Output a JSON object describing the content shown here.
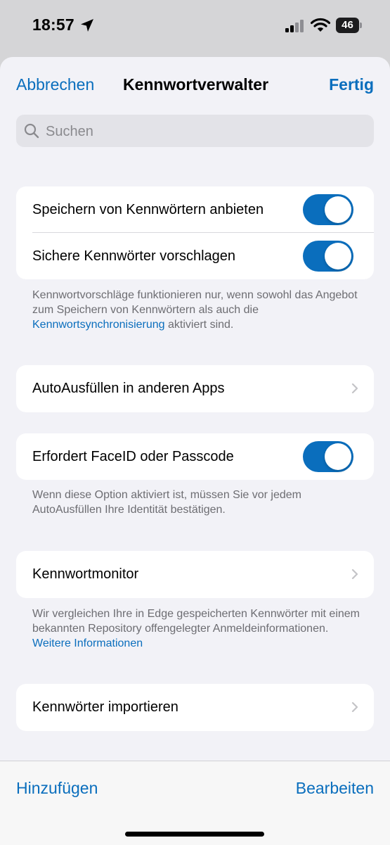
{
  "status_bar": {
    "time": "18:57",
    "battery": "46",
    "icons": [
      "location-arrow-icon",
      "cellular-signal-icon",
      "wifi-icon",
      "battery-icon"
    ]
  },
  "nav": {
    "cancel_label": "Abbrechen",
    "title": "Kennwortverwalter",
    "done_label": "Fertig"
  },
  "search": {
    "placeholder": "Suchen",
    "value": ""
  },
  "settings": {
    "offer_save": {
      "label": "Speichern von Kennwörtern anbieten",
      "enabled": true
    },
    "suggest_strong": {
      "label": "Sichere Kennwörter vorschlagen",
      "enabled": true
    },
    "sync_note": {
      "text_before": "Kennwortvorschläge funktionieren nur, wenn sowohl das Angebot zum Speichern von Kennwörtern als auch die ",
      "link": "Kennwortsynchronisierung",
      "text_after": " aktiviert sind."
    },
    "autofill_other_apps": {
      "label": "AutoAusfüllen in anderen Apps"
    },
    "require_faceid": {
      "label": "Erfordert FaceID oder Passcode",
      "enabled": true
    },
    "faceid_note": "Wenn diese Option aktiviert ist, müssen Sie vor jedem AutoAusfüllen Ihre Identität bestätigen.",
    "password_monitor": {
      "label": "Kennwortmonitor"
    },
    "monitor_note": {
      "text": "Wir vergleichen Ihre in Edge gespeicherten Kennwörter mit einem bekannten Repository offengelegter Anmeldeinformationen. ",
      "link": "Weitere Informationen"
    },
    "import_passwords": {
      "label": "Kennwörter importieren"
    }
  },
  "toolbar": {
    "add_label": "Hinzufügen",
    "edit_label": "Bearbeiten"
  },
  "colors": {
    "accent": "#0a6ebd",
    "background": "#f2f2f7",
    "card": "#ffffff",
    "secondary_text": "#6d6d72"
  }
}
